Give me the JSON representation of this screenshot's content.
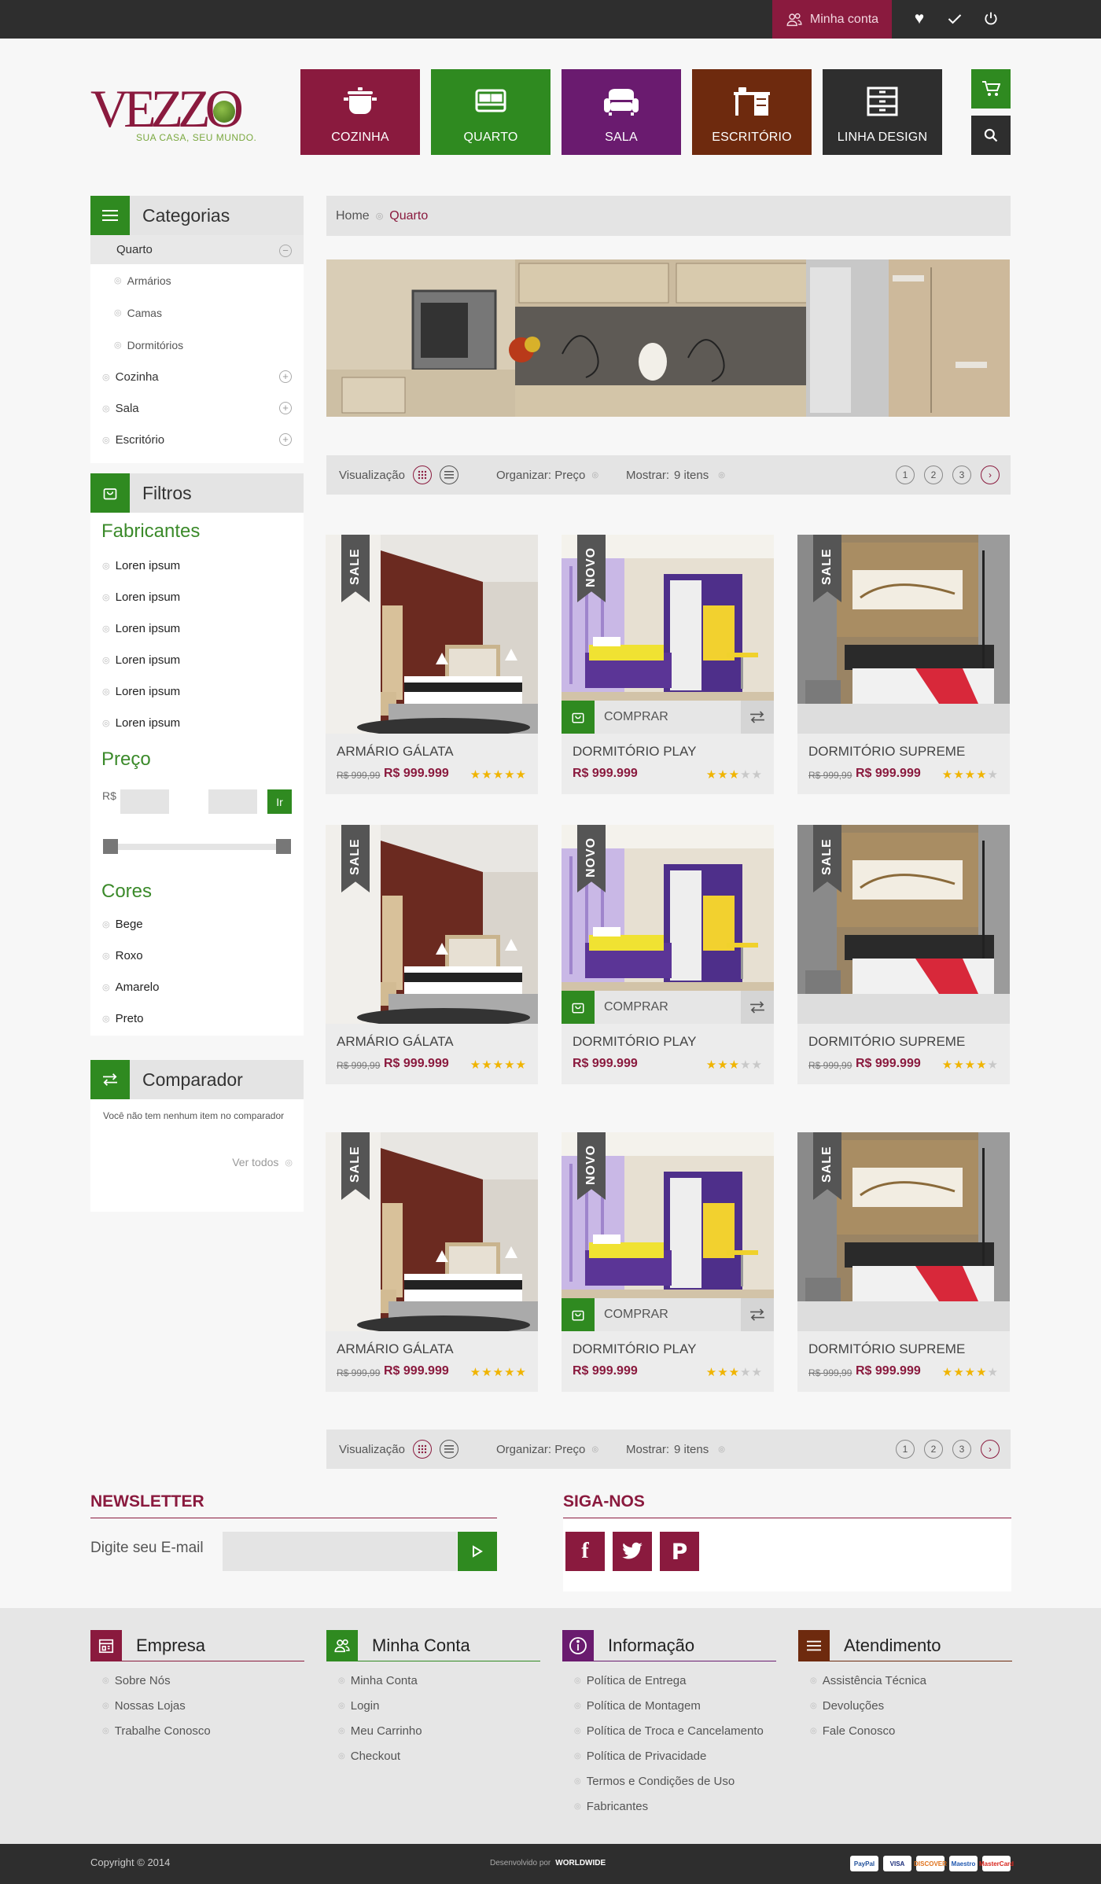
{
  "topbar": {
    "account_label": "Minha conta"
  },
  "logo": {
    "text": "VEZZO",
    "tagline": "SUA CASA, SEU MUNDO."
  },
  "categories_nav": [
    {
      "label": "COZINHA",
      "color": "#8a1a3e",
      "icon": "pot-icon"
    },
    {
      "label": "QUARTO",
      "color": "#2f8a20",
      "icon": "bed-icon"
    },
    {
      "label": "SALA",
      "color": "#6a1b6f",
      "icon": "sofa-icon"
    },
    {
      "label": "ESCRITÓRIO",
      "color": "#6e2a0e",
      "icon": "desk-icon"
    },
    {
      "label": "LINHA DESIGN",
      "color": "#2e2e2e",
      "icon": "drawers-icon"
    }
  ],
  "breadcrumb": {
    "home": "Home",
    "current": "Quarto"
  },
  "sidebar": {
    "categories_title": "Categorias",
    "categories": [
      {
        "label": "Quarto",
        "expanded": true,
        "children": [
          "Armários",
          "Camas",
          "Dormitórios"
        ]
      },
      {
        "label": "Cozinha",
        "expanded": false
      },
      {
        "label": "Sala",
        "expanded": false
      },
      {
        "label": "Escritório",
        "expanded": false
      }
    ],
    "filters_title": "Filtros",
    "manufacturers_title": "Fabricantes",
    "manufacturers": [
      "Loren ipsum",
      "Loren ipsum",
      "Loren ipsum",
      "Loren ipsum",
      "Loren ipsum",
      "Loren ipsum"
    ],
    "price_title": "Preço",
    "currency": "R$",
    "price_sep": "-",
    "price_go": "Ir",
    "colors_title": "Cores",
    "colors": [
      "Bege",
      "Roxo",
      "Amarelo",
      "Preto"
    ],
    "compare_title": "Comparador",
    "compare_empty": "Você não tem nenhum item no comparador",
    "compare_link": "Ver todos"
  },
  "toolbar": {
    "view_label": "Visualização",
    "sort_label": "Organizar: Preço",
    "show_label": "Mostrar:",
    "show_value": "9 itens",
    "pages": [
      "1",
      "2",
      "3"
    ]
  },
  "products": [
    {
      "name": "ARMÁRIO GÁLATA",
      "badge": "SALE",
      "old_price": "R$ 999,99",
      "price": "R$ 999.999",
      "rating": 5,
      "kind": "dark-bedroom"
    },
    {
      "name": "DORMITÓRIO PLAY",
      "badge": "NOVO",
      "old_price": "",
      "price": "R$ 999.999",
      "rating": 3,
      "buy": "COMPRAR",
      "kind": "kids-room"
    },
    {
      "name": "DORMITÓRIO SUPREME",
      "badge": "SALE",
      "old_price": "R$ 999,99",
      "price": "R$ 999.999",
      "rating": 4,
      "kind": "modern-bedroom"
    },
    {
      "name": "ARMÁRIO GÁLATA",
      "badge": "SALE",
      "old_price": "R$ 999,99",
      "price": "R$ 999.999",
      "rating": 5,
      "kind": "dark-bedroom"
    },
    {
      "name": "DORMITÓRIO PLAY",
      "badge": "NOVO",
      "old_price": "",
      "price": "R$ 999.999",
      "rating": 3,
      "buy": "COMPRAR",
      "kind": "kids-room"
    },
    {
      "name": "DORMITÓRIO SUPREME",
      "badge": "SALE",
      "old_price": "R$ 999,99",
      "price": "R$ 999.999",
      "rating": 4,
      "kind": "modern-bedroom"
    },
    {
      "name": "ARMÁRIO GÁLATA",
      "badge": "SALE",
      "old_price": "R$ 999,99",
      "price": "R$ 999.999",
      "rating": 5,
      "kind": "dark-bedroom"
    },
    {
      "name": "DORMITÓRIO PLAY",
      "badge": "NOVO",
      "old_price": "",
      "price": "R$ 999.999",
      "rating": 3,
      "buy": "COMPRAR",
      "kind": "kids-room"
    },
    {
      "name": "DORMITÓRIO SUPREME",
      "badge": "SALE",
      "old_price": "R$ 999,99",
      "price": "R$ 999.999",
      "rating": 4,
      "kind": "modern-bedroom"
    }
  ],
  "newsletter": {
    "title": "NEWSLETTER",
    "label": "Digite seu E-mail"
  },
  "social": {
    "title": "SIGA-NOS",
    "networks": [
      "facebook-icon",
      "twitter-icon",
      "pinterest-icon"
    ]
  },
  "footer": {
    "columns": [
      {
        "title": "Empresa",
        "color": "#8a1a3e",
        "links": [
          "Sobre Nós",
          "Nossas Lojas",
          "Trabalhe Conosco"
        ]
      },
      {
        "title": "Minha Conta",
        "color": "#2f8a20",
        "links": [
          "Minha Conta",
          "Login",
          "Meu Carrinho",
          "Checkout"
        ]
      },
      {
        "title": "Informação",
        "color": "#6a1b6f",
        "links": [
          "Política de Entrega",
          "Política de Montagem",
          "Política de Troca e Cancelamento",
          "Política de Privacidade",
          "Termos e Condições de Uso",
          "Fabricantes"
        ]
      },
      {
        "title": "Atendimento",
        "color": "#6e2a0e",
        "links": [
          "Assistência Técnica",
          "Devoluções",
          "Fale Conosco"
        ]
      }
    ],
    "copyright": "Copyright © 2014",
    "developed_by": "Desenvolvido por",
    "developer": "WORLDWIDE",
    "payments": [
      "PayPal",
      "VISA",
      "DISCOVER",
      "Maestro",
      "MasterCard"
    ]
  }
}
